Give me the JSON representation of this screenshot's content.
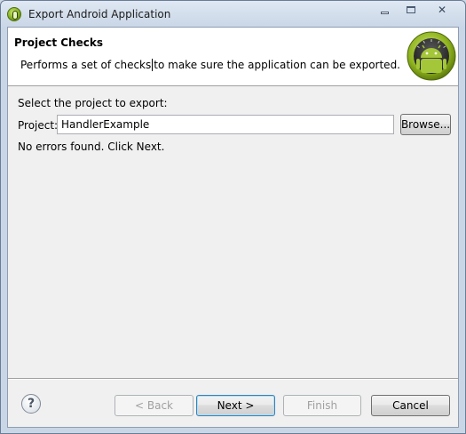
{
  "window": {
    "title": "Export Android Application"
  },
  "banner": {
    "title": "Project Checks",
    "description_before": "Performs a set of checks",
    "description_after": "to make sure the application can be exported."
  },
  "form": {
    "select_label": "Select the project to export:",
    "project_label": "Project:",
    "project_value": "HandlerExample",
    "browse_label": "Browse...",
    "status_text": "No errors found. Click Next."
  },
  "buttons": {
    "help": "?",
    "back": "< Back",
    "next": "Next >",
    "finish": "Finish",
    "cancel": "Cancel"
  },
  "icons": {
    "app": "android-adt-icon",
    "banner": "android-robot-icon",
    "minimize": "minimize-icon",
    "maximize": "maximize-icon",
    "close": "close-icon",
    "help": "help-icon"
  },
  "colors": {
    "android_green": "#a4c639",
    "default_button_border": "#3c7fb1"
  }
}
